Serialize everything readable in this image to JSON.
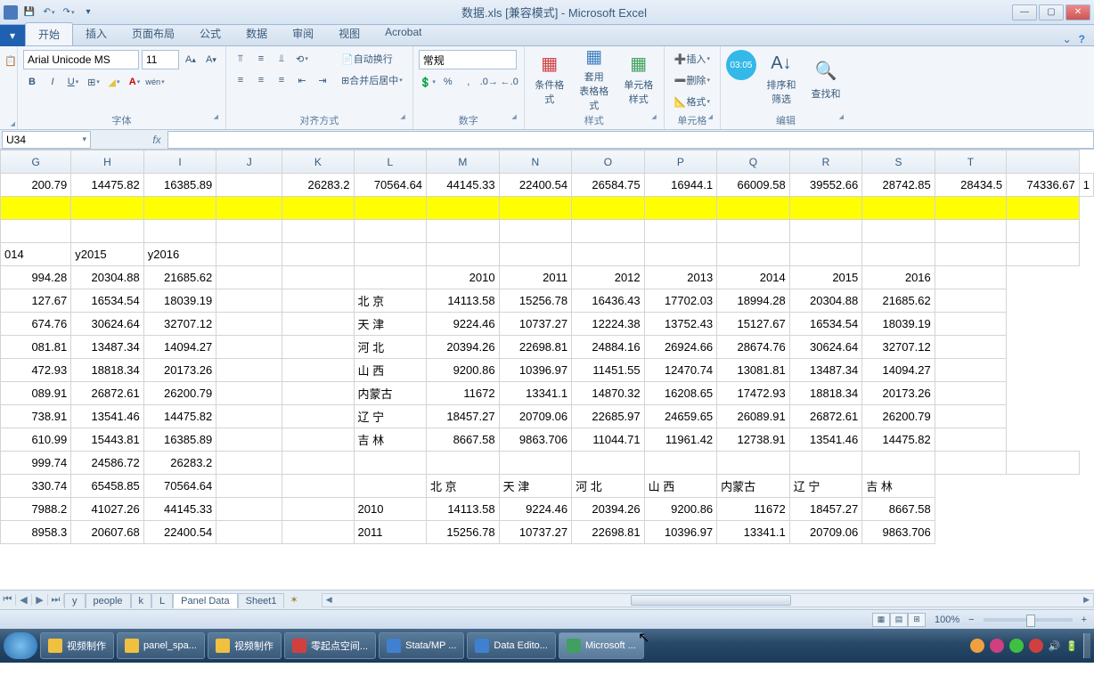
{
  "title": "数据.xls [兼容模式] - Microsoft Excel",
  "tabs": [
    "开始",
    "插入",
    "页面布局",
    "公式",
    "数据",
    "审阅",
    "视图",
    "Acrobat"
  ],
  "active_tab": 0,
  "font": {
    "name": "Arial Unicode MS",
    "size": "11"
  },
  "font_group_label": "字体",
  "align_group_label": "对齐方式",
  "number_group_label": "数字",
  "style_group_label": "样式",
  "cell_group_label": "单元格",
  "edit_group_label": "编辑",
  "wrap_text": "自动换行",
  "merge_center": "合并后居中",
  "number_format": "常规",
  "cond_fmt": "条件格式",
  "table_fmt": "套用\n表格格式",
  "cell_style": "单元格样式",
  "insert_label": "插入",
  "delete_label": "删除",
  "format_label": "格式",
  "sort_filter": "排序和筛选",
  "find_select": "查找和",
  "timer": "03:05",
  "namebox": "U34",
  "columns": [
    "G",
    "H",
    "I",
    "J",
    "K",
    "L",
    "M",
    "N",
    "O",
    "P",
    "Q",
    "R",
    "S",
    "T",
    ""
  ],
  "row_top": [
    "200.79",
    "14475.82",
    "16385.89",
    "",
    "26283.2",
    "70564.64",
    "44145.33",
    "22400.54",
    "26584.75",
    "16944.1",
    "66009.58",
    "39552.66",
    "28742.85",
    "28434.5",
    "74336.67",
    "1"
  ],
  "row_labels": [
    "014",
    "y2015",
    "y2016"
  ],
  "block1_header": [
    "",
    "",
    "",
    "",
    "",
    "",
    "2010",
    "2011",
    "2012",
    "2013",
    "2014",
    "2015",
    "2016",
    ""
  ],
  "block1": [
    [
      "994.28",
      "20304.88",
      "21685.62",
      "",
      "",
      "",
      "",
      "",
      "",
      "",
      "",
      "",
      "",
      "",
      ""
    ],
    [
      "127.67",
      "16534.54",
      "18039.19",
      "",
      "",
      "北 京",
      "14113.58",
      "15256.78",
      "16436.43",
      "17702.03",
      "18994.28",
      "20304.88",
      "21685.62",
      ""
    ],
    [
      "674.76",
      "30624.64",
      "32707.12",
      "",
      "",
      "天 津",
      "9224.46",
      "10737.27",
      "12224.38",
      "13752.43",
      "15127.67",
      "16534.54",
      "18039.19",
      ""
    ],
    [
      "081.81",
      "13487.34",
      "14094.27",
      "",
      "",
      "河 北",
      "20394.26",
      "22698.81",
      "24884.16",
      "26924.66",
      "28674.76",
      "30624.64",
      "32707.12",
      ""
    ],
    [
      "472.93",
      "18818.34",
      "20173.26",
      "",
      "",
      "山 西",
      "9200.86",
      "10396.97",
      "11451.55",
      "12470.74",
      "13081.81",
      "13487.34",
      "14094.27",
      ""
    ],
    [
      "089.91",
      "26872.61",
      "26200.79",
      "",
      "",
      "内蒙古",
      "11672",
      "13341.1",
      "14870.32",
      "16208.65",
      "17472.93",
      "18818.34",
      "20173.26",
      ""
    ],
    [
      "738.91",
      "13541.46",
      "14475.82",
      "",
      "",
      "辽 宁",
      "18457.27",
      "20709.06",
      "22685.97",
      "24659.65",
      "26089.91",
      "26872.61",
      "26200.79",
      ""
    ],
    [
      "610.99",
      "15443.81",
      "16385.89",
      "",
      "",
      "吉 林",
      "8667.58",
      "9863.706",
      "11044.71",
      "11961.42",
      "12738.91",
      "13541.46",
      "14475.82",
      ""
    ]
  ],
  "block2": [
    [
      "999.74",
      "24586.72",
      "26283.2",
      "",
      "",
      "",
      "",
      "",
      "",
      "",
      "",
      "",
      "",
      "",
      ""
    ],
    [
      "330.74",
      "65458.85",
      "70564.64",
      "",
      "",
      "",
      "北 京",
      "天 津",
      "河 北",
      "山 西",
      "内蒙古",
      "辽 宁",
      "吉 林"
    ],
    [
      "7988.2",
      "41027.26",
      "44145.33",
      "",
      "",
      "2010",
      "14113.58",
      "9224.46",
      "20394.26",
      "9200.86",
      "11672",
      "18457.27",
      "8667.58"
    ],
    [
      "8958.3",
      "20607.68",
      "22400.54",
      "",
      "",
      "2011",
      "15256.78",
      "10737.27",
      "22698.81",
      "10396.97",
      "13341.1",
      "20709.06",
      "9863.706"
    ]
  ],
  "sheets": [
    "y",
    "people",
    "k",
    "L",
    "Panel Data",
    "Sheet1"
  ],
  "active_sheet": 4,
  "zoom": "100%",
  "taskbar": [
    {
      "label": "视频制作",
      "ico": "#f0c040"
    },
    {
      "label": "panel_spa...",
      "ico": "#f0c040"
    },
    {
      "label": "视频制作",
      "ico": "#f0c040"
    },
    {
      "label": "零起点空间...",
      "ico": "#d04040"
    },
    {
      "label": "Stata/MP ...",
      "ico": "#4080d0"
    },
    {
      "label": "Data Edito...",
      "ico": "#4080d0"
    },
    {
      "label": "Microsoft ...",
      "ico": "#40a060",
      "active": true
    }
  ]
}
